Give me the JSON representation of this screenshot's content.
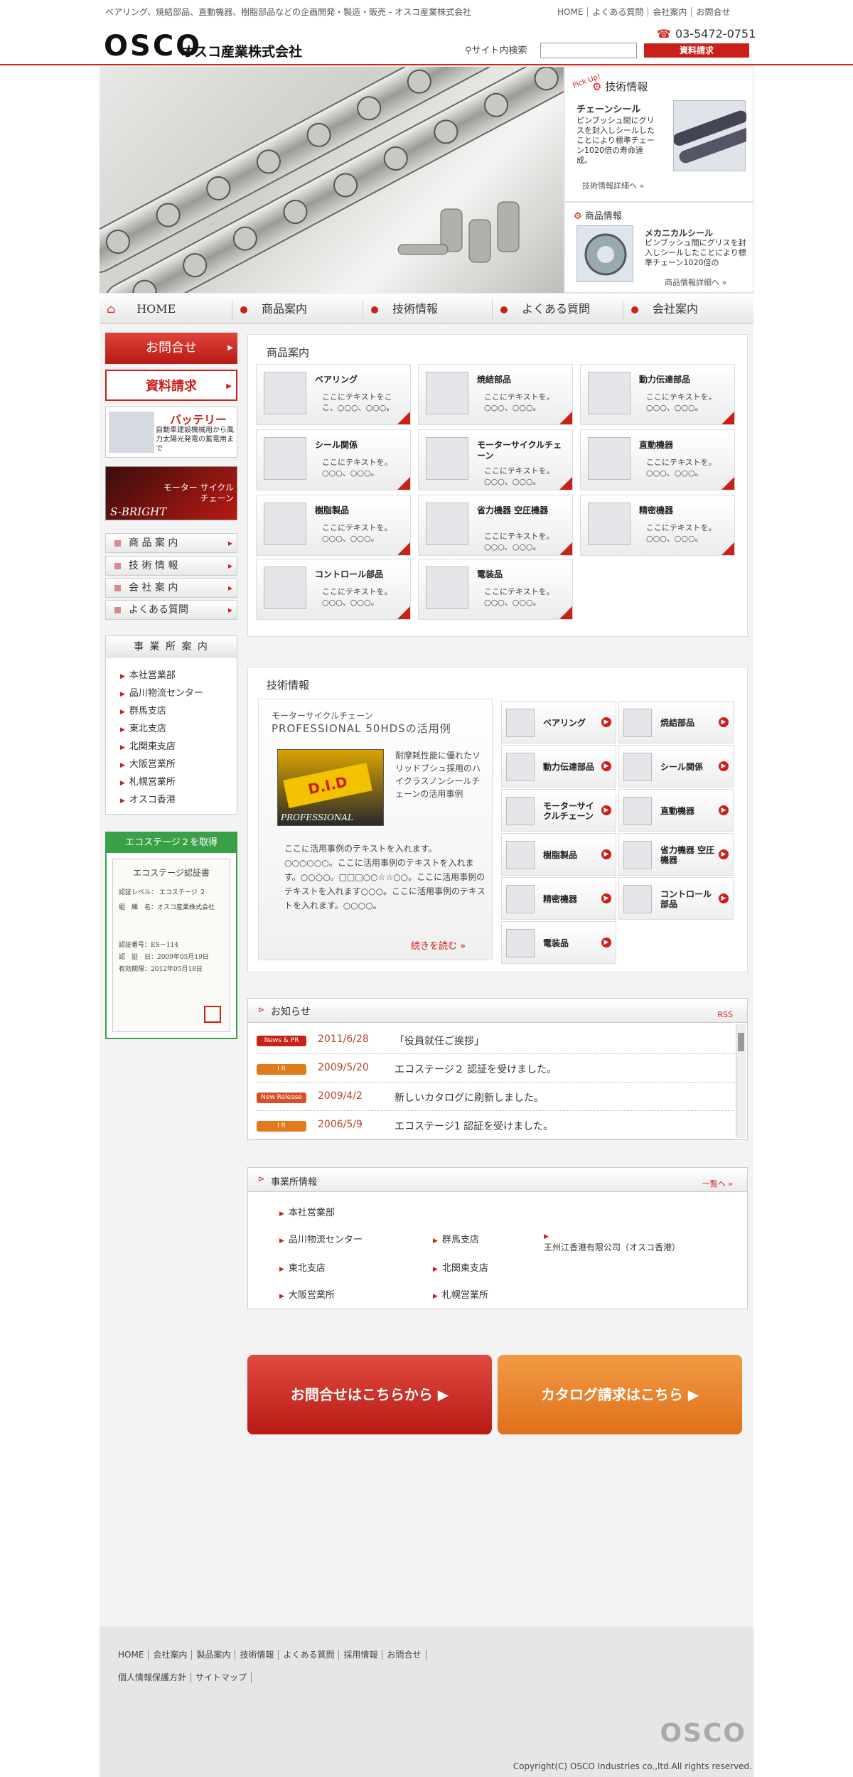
{
  "header": {
    "tagline": "ベアリング、焼結部品、直動機器、樹脂部品などの企画開発・製造・販売 - オスコ産業株式会社",
    "links": [
      "HOME",
      "よくある質問",
      "会社案内",
      "お問合せ"
    ],
    "logo_mark": "OSCO",
    "logo_jp": "オスコ産業株式会社",
    "phone": "03-5472-0751",
    "search_label": "サイト内検索",
    "request_button": "資料請求",
    "accent": "#d2241a"
  },
  "pickup": {
    "badge": "Pick Up!",
    "tech_title": "技術情報",
    "tech_name": "チェーンシール",
    "tech_desc": "ピンブッシュ間にグリスを封入しシールしたことにより標準チェーン1020倍の寿命達成。",
    "tech_link": "技術情報詳細へ",
    "product_title": "商品情報",
    "product_name": "メカニカルシール",
    "product_desc": "ピンブッシュ間にグリスを封入しシールしたことにより標準チェーン1020倍の",
    "product_link": "商品情報詳細へ"
  },
  "nav": [
    "HOME",
    "商品案内",
    "技術情報",
    "よくある質問",
    "会社案内"
  ],
  "sidebar": {
    "contact_button": "お問合せ",
    "request_button": "資料請求",
    "battery_title": "バッテリー",
    "battery_text": "自動車建設機械用から風力太陽光発電の蓄電用まで",
    "chain_title": "モーター サイクルチェーン",
    "chain_brand": "S-BRIGHT",
    "menu": [
      "商 品 案 内",
      "技 術 情 報",
      "会 社 案 内",
      "よくある質問"
    ],
    "office_title": "事 業 所 案 内",
    "offices": [
      "本社営業部",
      "品川物流センター",
      "群馬支店",
      "東北支店",
      "北関東支店",
      "大阪営業所",
      "札幌営業所",
      "オスコ香港"
    ],
    "eco_title": "エコステージ２を取得",
    "eco_cert_title": "エコステージ認証書",
    "eco_cert_level": "認証レベル： エコステージ ２",
    "eco_cert_company": "組　織　名：オスコ産業株式会社",
    "eco_cert_no": "認証番号：ES－114",
    "eco_cert_date1": "認　証　日：2009年05月19日",
    "eco_cert_date2": "有効期限：2012年05月18日"
  },
  "products": {
    "title": "商品案内",
    "items": [
      {
        "name": "ベアリング",
        "desc": "ここにテキストをここ、○○○、○○○。"
      },
      {
        "name": "焼結部品",
        "desc": "ここにテキストを。○○○、○○○。"
      },
      {
        "name": "動力伝達部品",
        "desc": "ここにテキストを。○○○、○○○。"
      },
      {
        "name": "シール関係",
        "desc": "ここにテキストを。○○○、○○○。"
      },
      {
        "name": "モーターサイクルチェーン",
        "desc": "ここにテキストを。○○○、○○○。"
      },
      {
        "name": "直動機器",
        "desc": "ここにテキストを。○○○、○○○。"
      },
      {
        "name": "樹脂製品",
        "desc": "ここにテキストを。○○○、○○○。"
      },
      {
        "name": "省力機器 空圧機器",
        "desc": "ここにテキストを。○○○、○○○。"
      },
      {
        "name": "精密機器",
        "desc": "ここにテキストを。○○○、○○○。"
      },
      {
        "name": "コントロール部品",
        "desc": "ここにテキストを。○○○、○○○。"
      },
      {
        "name": "電装品",
        "desc": "ここにテキストを。○○○、○○○。"
      }
    ]
  },
  "tech": {
    "title": "技術情報",
    "feature_sub": "モーターサイクルチェーン",
    "feature_title": "PROFESSIONAL 50HDSの活用例",
    "feature_desc": "耐摩耗性能に優れたソリッドブシュ採用のハイクラスノンシールチェーンの活用事例",
    "feature_img_label": "PROFESSIONAL",
    "feature_body": "ここに活用事例のテキストを入れます。○○○○○○。ここに活用事例のテキストを入れます。○○○○。□□□○○☆☆○○。ここに活用事例のテキストを入れます○○○。ここに活用事例のテキストを入れます。○○○○。",
    "feature_more": "続きを読む »",
    "items": [
      "ベアリング",
      "焼結部品",
      "動力伝達部品",
      "シール関係",
      "モーターサイクルチェーン",
      "直動機器",
      "樹脂製品",
      "省力機器 空圧機器",
      "精密機器",
      "コントロール部品",
      "電装品"
    ]
  },
  "news": {
    "title": "お知らせ",
    "rss": "RSS",
    "items": [
      {
        "badge": "News & PR",
        "color": "#c9201a",
        "date": "2011/6/28",
        "text": "「役員就任ご挨拶」"
      },
      {
        "badge": "I R",
        "color": "#e07a1a",
        "date": "2009/5/20",
        "text": "エコステージ２ 認証を受けました。"
      },
      {
        "badge": "New Release",
        "color": "#d8502a",
        "date": "2009/4/2",
        "text": "新しいカタログに刷新しました。"
      },
      {
        "badge": "I R",
        "color": "#e07a1a",
        "date": "2006/5/9",
        "text": "エコステージ1 認証を受けました。"
      }
    ]
  },
  "offices_info": {
    "title": "事業所情報",
    "more": "一覧へ »",
    "items": [
      "本社営業部",
      "品川物流センター",
      "群馬支店",
      "王州江香港有限公司（オスコ香港）",
      "東北支店",
      "北関東支店",
      "大阪営業所",
      "札幌営業所"
    ]
  },
  "cta": {
    "contact": "お問合せはこちらから ▶",
    "catalog": "カタログ請求はこちら ▶"
  },
  "footer": {
    "links": [
      "HOME",
      "会社案内",
      "製品案内",
      "技術情報",
      "よくある質問",
      "採用情報",
      "お問合せ",
      "個人情報保護方針",
      "サイトマップ"
    ],
    "logo": "OSCO",
    "copyright": "Copyright(C) OSCO Industries co.,ltd.All rights reserved."
  }
}
